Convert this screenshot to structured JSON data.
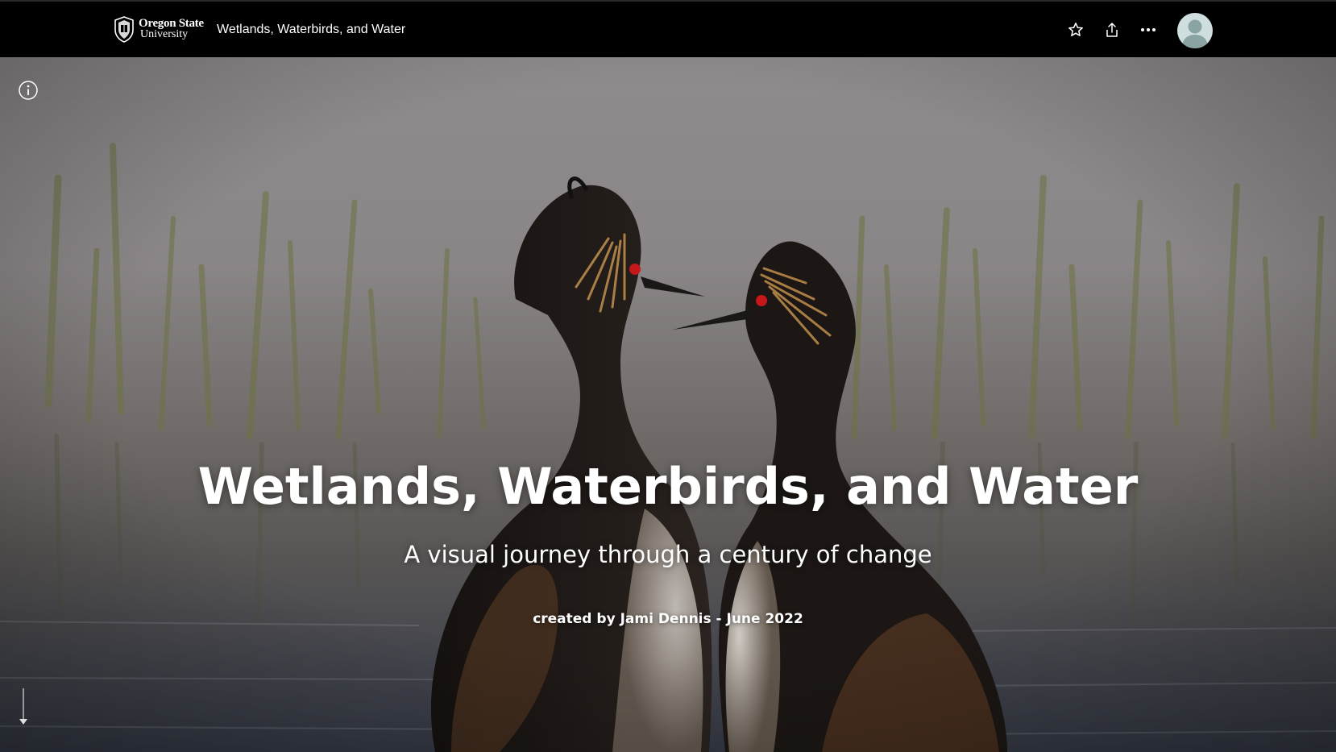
{
  "header": {
    "logo": {
      "line1": "Oregon State",
      "line2": "University"
    },
    "title": "Wetlands, Waterbirds, and Water",
    "actions": {
      "favorite_icon": "star-icon",
      "share_icon": "share-icon",
      "more_icon": "more-horizontal-icon",
      "profile_icon": "user-avatar-icon"
    }
  },
  "hero": {
    "title": "Wetlands, Waterbirds, and Water",
    "subtitle": "A visual journey through a century of change",
    "byline": "created by Jami Dennis - June 2022",
    "info_icon": "info-icon",
    "scroll_icon": "arrow-down-icon",
    "image_subject": "two eared grebes facing each other in a marsh"
  },
  "colors": {
    "header_bg": "#000000",
    "text": "#ffffff",
    "avatar_bg": "#cfdede",
    "avatar_figure": "#8aa3a3"
  }
}
